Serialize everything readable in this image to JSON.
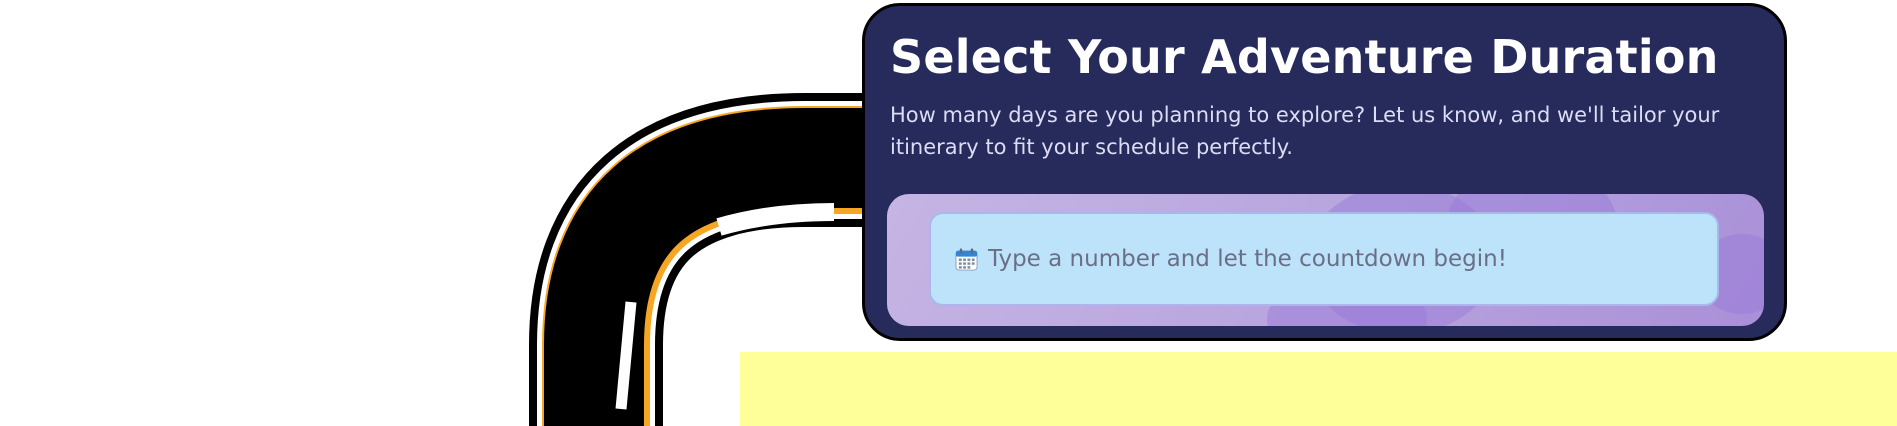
{
  "card": {
    "title": "Select Your Adventure Duration",
    "subtitle": "How many days are you planning to explore? Let us know, and we'll tailor your itinerary to fit your schedule perfectly."
  },
  "duration_input": {
    "icon": "calendar-icon",
    "placeholder": "Type a number and let the countdown begin!",
    "value": ""
  },
  "colors": {
    "card_background": "#262b5c",
    "panel_background": "#b6a2dd",
    "input_background": "#bde3fb",
    "road": "#000000",
    "road_edge_accent": "#f6a623",
    "band": "#ffff99"
  }
}
